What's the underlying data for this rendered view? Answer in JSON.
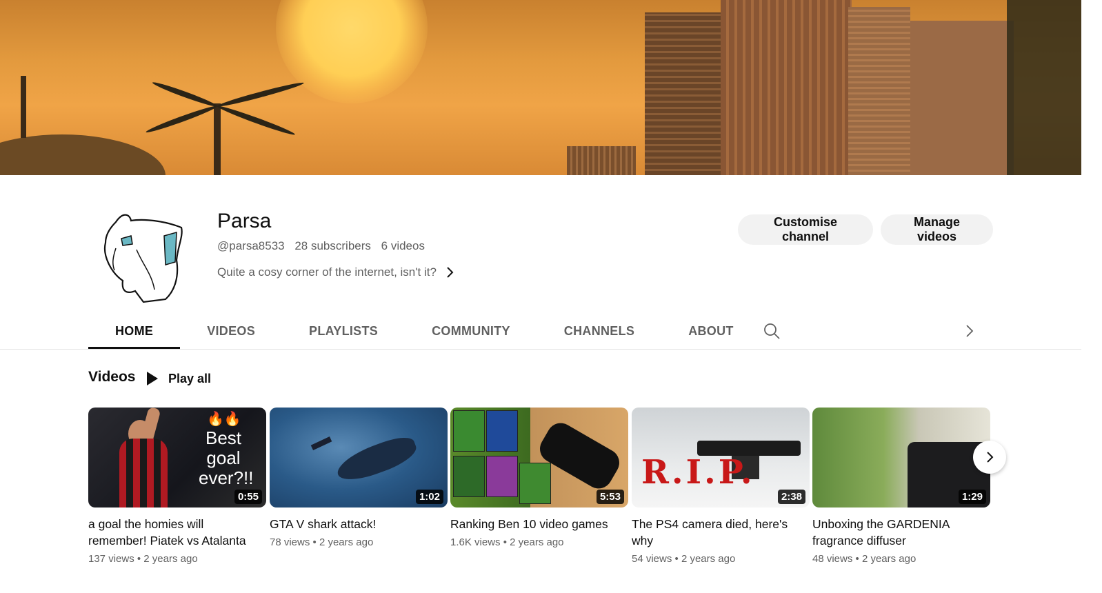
{
  "channel": {
    "name": "Parsa",
    "handle": "@parsa8533",
    "subscribers": "28 subscribers",
    "videos_count": "6 videos",
    "description": "Quite a cosy corner of the internet, isn't it?"
  },
  "actions": {
    "customise": "Customise channel",
    "manage": "Manage videos"
  },
  "tabs": [
    {
      "label": "HOME",
      "active": true
    },
    {
      "label": "VIDEOS",
      "active": false
    },
    {
      "label": "PLAYLISTS",
      "active": false
    },
    {
      "label": "COMMUNITY",
      "active": false
    },
    {
      "label": "CHANNELS",
      "active": false
    },
    {
      "label": "ABOUT",
      "active": false
    }
  ],
  "section": {
    "title": "Videos",
    "play_all": "Play all"
  },
  "videos": [
    {
      "title": "a goal the homies will remember! Piatek vs Atalanta",
      "duration": "0:55",
      "views": "137 views",
      "age": "2 years ago",
      "thumb_text": "Best goal ever?!!",
      "thumb_emoji": "🔥🔥"
    },
    {
      "title": "GTA V shark attack!",
      "duration": "1:02",
      "views": "78 views",
      "age": "2 years ago"
    },
    {
      "title": "Ranking Ben 10 video games",
      "duration": "5:53",
      "views": "1.6K views",
      "age": "2 years ago"
    },
    {
      "title": "The PS4 camera died, here's why",
      "duration": "2:38",
      "views": "54 views",
      "age": "2 years ago",
      "thumb_text": "R.I.P."
    },
    {
      "title": "Unboxing the GARDENIA fragrance diffuser",
      "duration": "1:29",
      "views": "48 views",
      "age": "2 years ago"
    }
  ],
  "icons": {
    "search": "search-icon",
    "chevron": "chevron-right-icon",
    "play": "play-icon"
  }
}
